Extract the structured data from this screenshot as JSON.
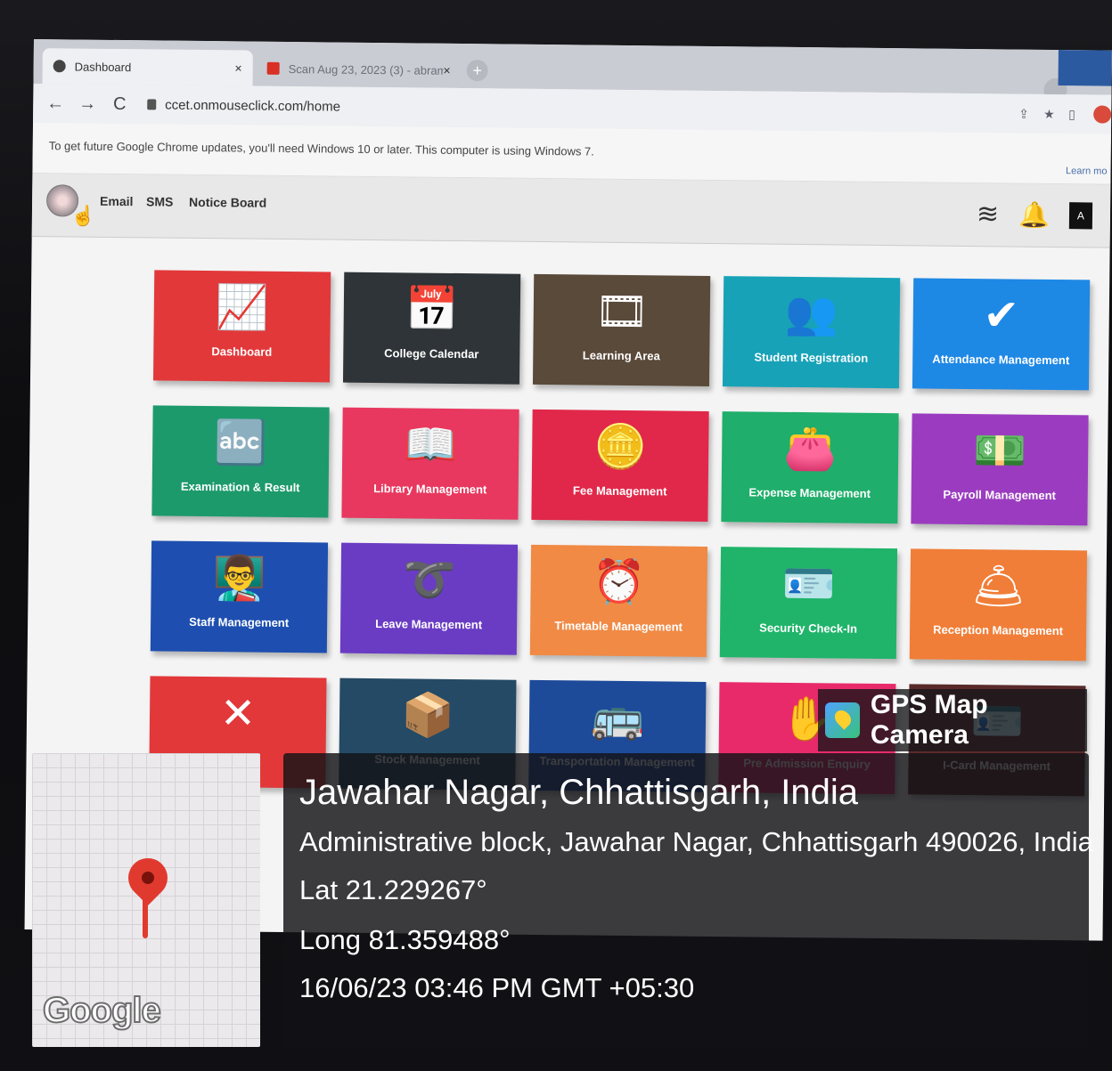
{
  "browser": {
    "tabs": [
      {
        "label": "Dashboard",
        "close": "×"
      },
      {
        "label": "Scan Aug 23, 2023 (3) - abram...",
        "close": "×"
      }
    ],
    "new_tab": "+",
    "nav": {
      "back": "←",
      "forward": "→",
      "reload": "C"
    },
    "url": "ccet.onmouseclick.com/home",
    "update_notice": "To get future Google Chrome updates, you'll need Windows 10 or later. This computer is using Windows 7.",
    "learn_more": "Learn mo"
  },
  "header": {
    "menu": [
      "Email",
      "SMS",
      "Notice Board"
    ],
    "avatar_letter": "A"
  },
  "tiles": [
    {
      "label": "Dashboard",
      "icon": "chart-icon",
      "glyph": "📈",
      "color": "#e2383a"
    },
    {
      "label": "College Calendar",
      "icon": "calendar-icon",
      "glyph": "📅",
      "color": "#2e3438"
    },
    {
      "label": "Learning Area",
      "icon": "film-icon",
      "glyph": "🎞",
      "color": "#5a4a3a"
    },
    {
      "label": "Student Registration",
      "icon": "students-icon",
      "glyph": "👥",
      "color": "#17a2b8"
    },
    {
      "label": "Attendance Management",
      "icon": "check-icon",
      "glyph": "✔",
      "color": "#1e88e5"
    },
    {
      "label": "Examination & Result",
      "icon": "abc-blocks-icon",
      "glyph": "🔤",
      "color": "#1d9a6c"
    },
    {
      "label": "Library Management",
      "icon": "reader-icon",
      "glyph": "📖",
      "color": "#e8385f"
    },
    {
      "label": "Fee Management",
      "icon": "coins-icon",
      "glyph": "🪙",
      "color": "#e1284a"
    },
    {
      "label": "Expense Management",
      "icon": "wallet-icon",
      "glyph": "👛",
      "color": "#1fae6b"
    },
    {
      "label": "Payroll Management",
      "icon": "money-icon",
      "glyph": "💵",
      "color": "#9b3cc0"
    },
    {
      "label": "Staff Management",
      "icon": "staff-icon",
      "glyph": "👨‍🏫",
      "color": "#1e4fb0"
    },
    {
      "label": "Leave Management",
      "icon": "leave-icon",
      "glyph": "➰",
      "color": "#6a3cc4"
    },
    {
      "label": "Timetable Management",
      "icon": "alarm-clock-icon",
      "glyph": "⏰",
      "color": "#f08a45"
    },
    {
      "label": "Security Check-In",
      "icon": "id-badge-icon",
      "glyph": "🪪",
      "color": "#1fb46a"
    },
    {
      "label": "Reception Management",
      "icon": "bell-tray-icon",
      "glyph": "🛎",
      "color": "#f07e38"
    },
    {
      "label": "",
      "icon": "strategy-icon",
      "glyph": "✕",
      "color": "#e2383a"
    },
    {
      "label": "Stock Management",
      "icon": "boxes-icon",
      "glyph": "📦",
      "color": "#244a66"
    },
    {
      "label": "Transportation Management",
      "icon": "bus-icon",
      "glyph": "🚌",
      "color": "#1e4a9a"
    },
    {
      "label": "Pre Admission Enquiry",
      "icon": "hand-icon",
      "glyph": "✋",
      "color": "#e82a6a"
    },
    {
      "label": "I-Card Management",
      "icon": "id-card-icon",
      "glyph": "🪪",
      "color": "#5a2a2a"
    }
  ],
  "overlay": {
    "app_name": "GPS Map Camera",
    "place": "Jawahar Nagar, Chhattisgarh, India",
    "address": "Administrative block, Jawahar Nagar, Chhattisgarh 490026, India",
    "lat": "Lat 21.229267°",
    "long": "Long 81.359488°",
    "timestamp": "16/06/23 03:46 PM GMT +05:30",
    "map_brand": "Google"
  }
}
